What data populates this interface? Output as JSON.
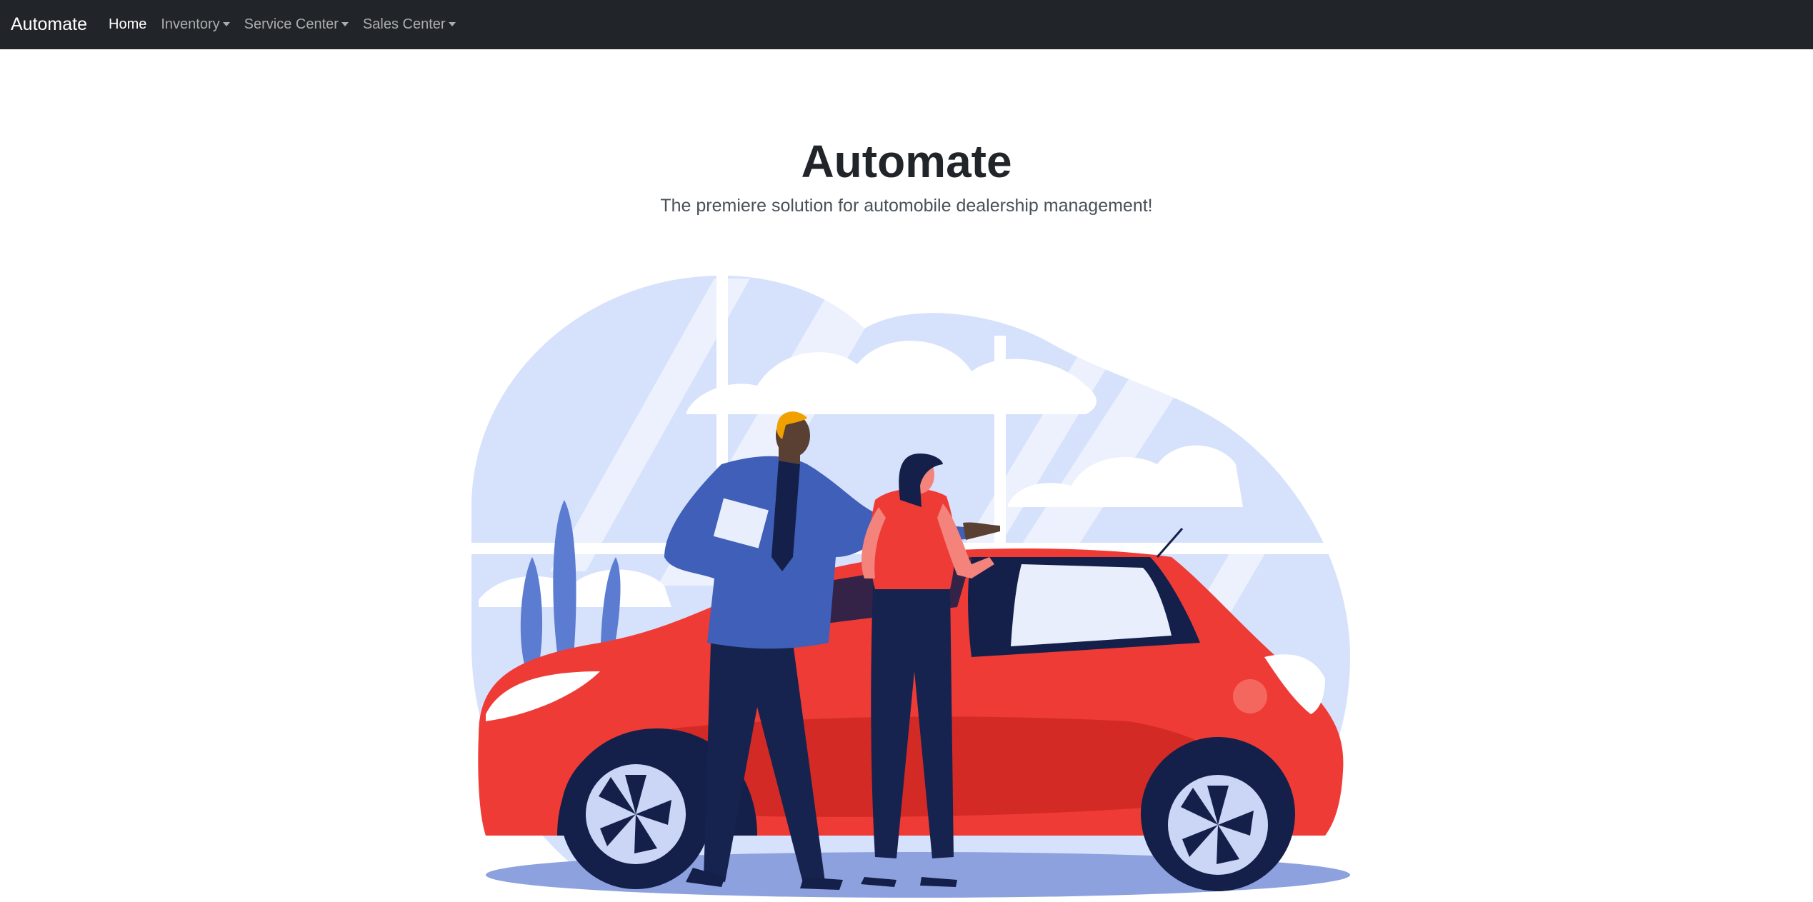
{
  "navbar": {
    "brand": "Automate",
    "items": [
      {
        "label": "Home",
        "active": true,
        "dropdown": false
      },
      {
        "label": "Inventory",
        "active": false,
        "dropdown": true
      },
      {
        "label": "Service Center",
        "active": false,
        "dropdown": true
      },
      {
        "label": "Sales Center",
        "active": false,
        "dropdown": true
      }
    ]
  },
  "hero": {
    "title": "Automate",
    "subtitle": "The premiere solution for automobile dealership management!"
  },
  "illustration": {
    "icon": "car-dealership-illustration",
    "colors": {
      "background_blob": "#d6e1fb",
      "window_frame": "#ffffff",
      "car_body": "#ef3b36",
      "car_dark": "#d42a26",
      "wheel": "#14204a",
      "rim": "#cbd6f6",
      "shadow": "#8da1df",
      "suit": "#3f5fb8",
      "pants": "#17234f",
      "woman_top": "#ef3b36",
      "skin": "#5a3f33",
      "skin_light": "#f3837b",
      "hair_blonde": "#f0a100",
      "plant": "#5b7cd1"
    }
  }
}
